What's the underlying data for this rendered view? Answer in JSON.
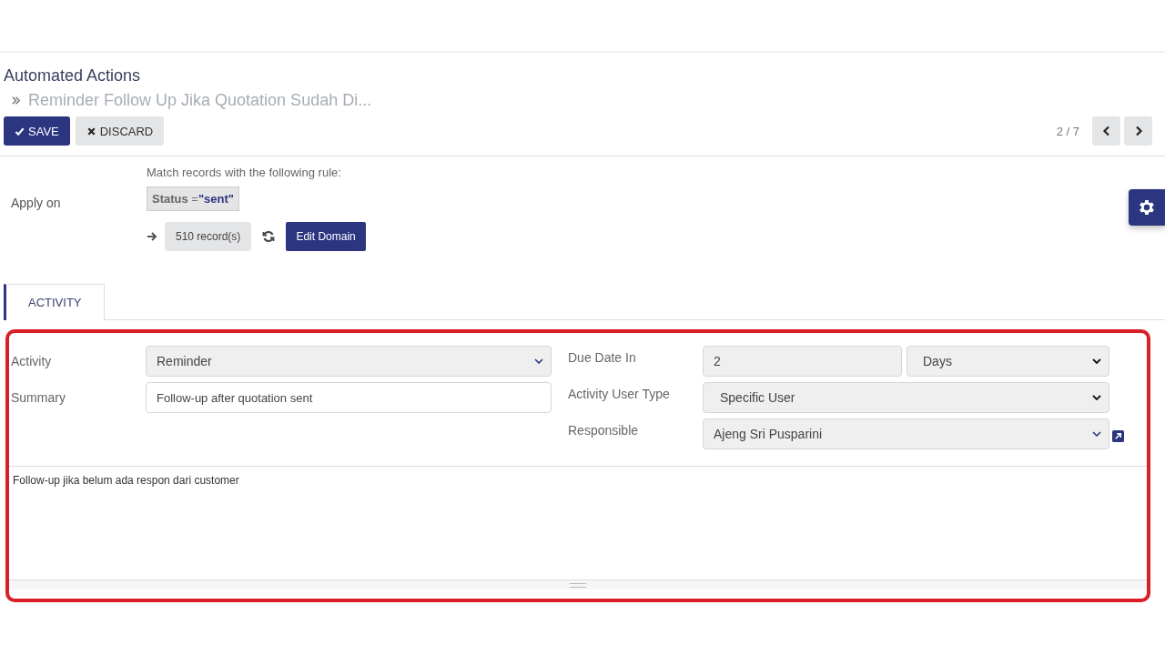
{
  "breadcrumb": {
    "parent": "Automated Actions",
    "current": "Reminder Follow Up Jika Quotation Sudah Di..."
  },
  "buttons": [
    {
      "kind": "primary",
      "label": "SAVE"
    },
    {
      "kind": "secondary",
      "label": "DISCARD"
    }
  ],
  "pager": "2 / 7",
  "apply_on": {
    "label": "Apply on",
    "rule_hint": "Match records with the following rule:",
    "domain": {
      "field": "Status",
      "operator": "=",
      "value": "\"sent\""
    },
    "record_count": "510 record(s)",
    "edit_button": "Edit Domain"
  },
  "tabs": [
    {
      "label": "ACTIVITY",
      "selected": true
    }
  ],
  "left_fields": [
    {
      "label": "Activity",
      "kind": "select",
      "value": "Reminder"
    },
    {
      "label": "Summary",
      "kind": "input",
      "value": "Follow-up after quotation sent"
    }
  ],
  "right_fields": [
    {
      "label": "Due Date In",
      "kind": "number_unit",
      "value": "2",
      "unit": "Days"
    },
    {
      "label": "Activity User Type",
      "kind": "dropdown",
      "value": "Specific User"
    },
    {
      "label": "Responsible",
      "kind": "many2one",
      "value": "Ajeng Sri Pusparini"
    }
  ],
  "note": "Follow-up jika belum ada respon dari customer"
}
